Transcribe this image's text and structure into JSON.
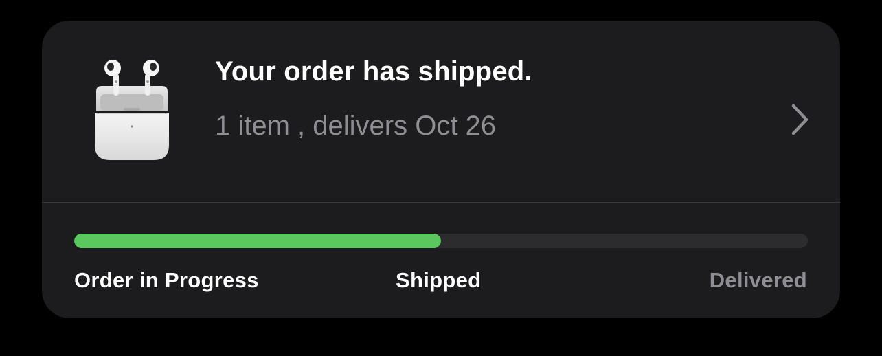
{
  "order": {
    "title": "Your order has shipped.",
    "subtitle": "1 item , delivers Oct 26",
    "product_icon": "airpods-icon",
    "chevron_icon": "chevron-right-icon"
  },
  "progress": {
    "fraction": 0.5,
    "fill_color": "#5ac85f",
    "track_color": "#2c2c2e",
    "stages": [
      {
        "label": "Order in Progress",
        "state": "complete"
      },
      {
        "label": "Shipped",
        "state": "current"
      },
      {
        "label": "Delivered",
        "state": "pending"
      }
    ]
  },
  "colors": {
    "background": "#000000",
    "card": "#1c1c1e",
    "text_primary": "#ffffff",
    "text_secondary": "#8e8e93"
  }
}
